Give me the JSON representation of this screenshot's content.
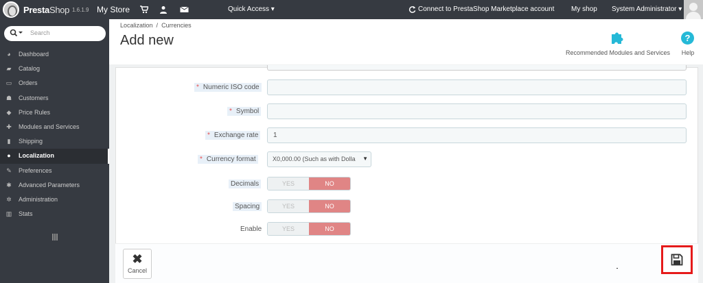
{
  "topbar": {
    "brand_main": "Presta",
    "brand_sub": "Shop",
    "version": "1.6.1.9",
    "store_name": "My Store",
    "quick_access": "Quick Access ▾",
    "connect": "Connect to PrestaShop Marketplace account",
    "my_shop": "My shop",
    "user": "System Administrator ▾"
  },
  "sidebar": {
    "search_placeholder": "Search",
    "items": [
      {
        "label": "Dashboard",
        "icon": "dashboard-icon"
      },
      {
        "label": "Catalog",
        "icon": "book-icon"
      },
      {
        "label": "Orders",
        "icon": "credit-card-icon"
      },
      {
        "label": "Customers",
        "icon": "users-icon"
      },
      {
        "label": "Price Rules",
        "icon": "tag-icon"
      },
      {
        "label": "Modules and Services",
        "icon": "puzzle-icon"
      },
      {
        "label": "Shipping",
        "icon": "truck-icon"
      },
      {
        "label": "Localization",
        "icon": "globe-icon"
      },
      {
        "label": "Preferences",
        "icon": "wrench-icon"
      },
      {
        "label": "Advanced Parameters",
        "icon": "cogs-icon"
      },
      {
        "label": "Administration",
        "icon": "cog-icon"
      },
      {
        "label": "Stats",
        "icon": "bar-chart-icon"
      }
    ],
    "active": "Localization"
  },
  "header": {
    "breadcrumb_1": "Localization",
    "breadcrumb_sep": "/",
    "breadcrumb_2": "Currencies",
    "title": "Add new",
    "recommended": "Recommended Modules and Services",
    "help": "Help"
  },
  "form": {
    "numeric_iso_label": "Numeric ISO code",
    "numeric_iso_value": "",
    "symbol_label": "Symbol",
    "symbol_value": "",
    "exchange_rate_label": "Exchange rate",
    "exchange_rate_value": "1",
    "currency_format_label": "Currency format",
    "currency_format_value": "X0,000.00 (Such as with Dolla",
    "decimals_label": "Decimals",
    "spacing_label": "Spacing",
    "enable_label": "Enable",
    "yes": "YES",
    "no": "NO",
    "required_mark": "*"
  },
  "footer": {
    "cancel": "Cancel"
  }
}
